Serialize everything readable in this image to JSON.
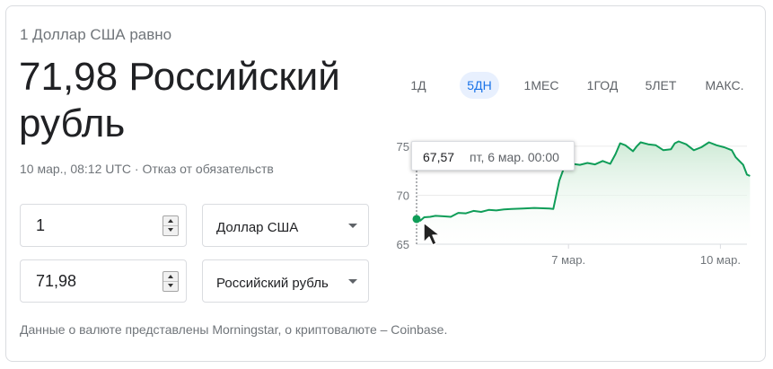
{
  "converter": {
    "subtitle": "1 Доллар США равно",
    "result_value": "71,98",
    "result_currency": "Российский рубль",
    "timestamp": "10 мар., 08:12 UTC",
    "separator": "·",
    "disclaimer": "Отказ от обязательств",
    "from_amount": "1",
    "from_currency": "Доллар США",
    "to_amount": "71,98",
    "to_currency": "Российский рубль",
    "footer": "Данные о валюте представлены Morningstar, о криптовалюте – Coinbase."
  },
  "range_tabs": [
    {
      "label": "1Д",
      "active": false
    },
    {
      "label": "5ДН",
      "active": true
    },
    {
      "label": "1МЕС",
      "active": false
    },
    {
      "label": "1ГОД",
      "active": false
    },
    {
      "label": "5ЛЕТ",
      "active": false
    },
    {
      "label": "МАКС.",
      "active": false
    }
  ],
  "tooltip": {
    "value": "67,57",
    "date": "пт, 6 мар. 00:00"
  },
  "colors": {
    "line": "#0f9d58",
    "area": "#e6f4ea",
    "active_tab": "#1a73e8",
    "active_tab_bg": "#e8f0fe"
  },
  "chart_data": {
    "type": "area",
    "y_ticks": [
      "75",
      "70",
      "65"
    ],
    "y_tick_values": [
      75,
      70,
      65
    ],
    "x_ticks": [
      "7 мар.",
      "10 мар."
    ],
    "x_tick_positions": [
      2.0,
      4.0
    ],
    "ylim": [
      65,
      76
    ],
    "xlim": [
      0,
      4.35
    ],
    "grid": true,
    "series": [
      {
        "values": [
          [
            0.0,
            67.57
          ],
          [
            0.05,
            67.4
          ],
          [
            0.1,
            67.75
          ],
          [
            0.18,
            67.8
          ],
          [
            0.25,
            67.9
          ],
          [
            0.35,
            67.85
          ],
          [
            0.45,
            67.8
          ],
          [
            0.55,
            68.2
          ],
          [
            0.65,
            68.15
          ],
          [
            0.75,
            68.4
          ],
          [
            0.85,
            68.3
          ],
          [
            0.95,
            68.5
          ],
          [
            1.05,
            68.45
          ],
          [
            1.15,
            68.55
          ],
          [
            1.25,
            68.6
          ],
          [
            1.4,
            68.65
          ],
          [
            1.55,
            68.7
          ],
          [
            1.75,
            68.65
          ],
          [
            1.8,
            68.6
          ],
          [
            1.88,
            71.5
          ],
          [
            1.95,
            73.0
          ],
          [
            2.05,
            73.2
          ],
          [
            2.15,
            73.1
          ],
          [
            2.25,
            73.3
          ],
          [
            2.35,
            73.15
          ],
          [
            2.45,
            73.5
          ],
          [
            2.55,
            73.2
          ],
          [
            2.62,
            74.2
          ],
          [
            2.68,
            75.3
          ],
          [
            2.75,
            75.1
          ],
          [
            2.85,
            74.5
          ],
          [
            2.9,
            75.0
          ],
          [
            2.95,
            75.4
          ],
          [
            3.05,
            75.2
          ],
          [
            3.15,
            75.1
          ],
          [
            3.25,
            74.6
          ],
          [
            3.35,
            74.7
          ],
          [
            3.4,
            75.3
          ],
          [
            3.45,
            75.5
          ],
          [
            3.55,
            75.2
          ],
          [
            3.65,
            74.6
          ],
          [
            3.75,
            74.9
          ],
          [
            3.85,
            75.4
          ],
          [
            3.95,
            75.1
          ],
          [
            4.05,
            74.9
          ],
          [
            4.15,
            74.6
          ],
          [
            4.2,
            73.9
          ],
          [
            4.3,
            73.1
          ],
          [
            4.35,
            72.1
          ],
          [
            4.39,
            71.98
          ]
        ]
      }
    ]
  }
}
